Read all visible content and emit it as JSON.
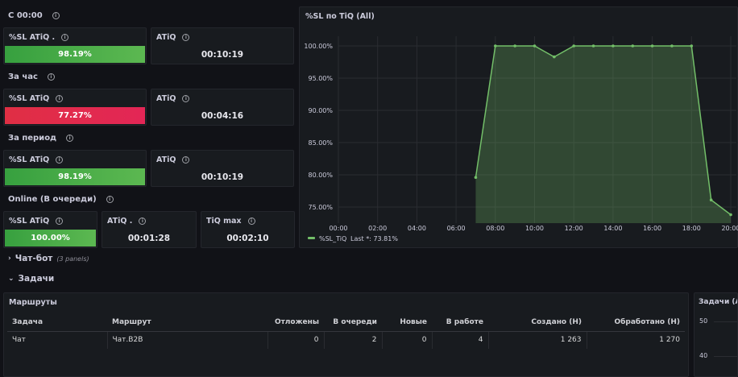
{
  "sections": {
    "since_midnight": "С 00:00",
    "per_hour": "За час",
    "per_period": "За период",
    "online": "Online (В очереди)"
  },
  "stats": {
    "r1_sl_title": "%SL ATiQ .",
    "r1_sl_value": "98.19%",
    "r1_atiq_title": "ATiQ",
    "r1_atiq_value": "00:10:19",
    "r2_sl_title": "%SL ATiQ",
    "r2_sl_value": "77.27%",
    "r2_atiq_title": "ATiQ",
    "r2_atiq_value": "00:04:16",
    "r3_sl_title": "%SL ATiQ",
    "r3_sl_value": "98.19%",
    "r3_atiq_title": "ATiQ",
    "r3_atiq_value": "00:10:19",
    "r4_sl_title": "%SL ATiQ",
    "r4_sl_value": "100.00%",
    "r4_atiq_title": "ATiQ .",
    "r4_atiq_value": "00:01:28",
    "r4_tiqmax_title": "TiQ max",
    "r4_tiqmax_value": "00:02:10"
  },
  "colors": {
    "ok": "#56a64b",
    "bad": "#e02f44",
    "series": "#73bf69"
  },
  "chart_panel": {
    "title": "%SL по TiQ (All)",
    "legend_name": "%SL_TiQ",
    "legend_last": "Last *: 73.81%"
  },
  "chart_data": {
    "type": "area",
    "x": [
      "07:00",
      "08:00",
      "09:00",
      "10:00",
      "11:00",
      "12:00",
      "13:00",
      "14:00",
      "15:00",
      "16:00",
      "17:00",
      "18:00",
      "19:00",
      "20:00"
    ],
    "series": [
      {
        "name": "%SL_TiQ",
        "values": [
          79.6,
          100,
          100,
          100,
          98.3,
          100,
          100,
          100,
          100,
          100,
          100,
          100,
          76.1,
          73.81
        ]
      }
    ],
    "x_ticks": [
      "00:00",
      "02:00",
      "04:00",
      "06:00",
      "08:00",
      "10:00",
      "12:00",
      "14:00",
      "16:00",
      "18:00",
      "20:00"
    ],
    "y_ticks": [
      "75.00%",
      "80.00%",
      "85.00%",
      "90.00%",
      "95.00%",
      "100.00%"
    ],
    "ylim": [
      72.5,
      101.5
    ],
    "grid": true,
    "legend": "bottom-left"
  },
  "rows": [
    {
      "label": "Чат-бот",
      "sub": "(3 panels)",
      "expanded": false
    },
    {
      "label": "Задачи",
      "sub": "",
      "expanded": true
    }
  ],
  "routes": {
    "title": "Маршруты",
    "columns": [
      "Задача",
      "Маршрут",
      "Отложены",
      "В очереди",
      "Новые",
      "В работе",
      "Создано (Н)",
      "Обработано (Н)"
    ],
    "data": [
      [
        "Чат",
        "Чат.B2B",
        "0",
        "2",
        "0",
        "4",
        "1 263",
        "1 270"
      ]
    ]
  },
  "tasks_panel": {
    "title": "Задачи (All",
    "y_ticks": [
      "50",
      "40"
    ]
  }
}
